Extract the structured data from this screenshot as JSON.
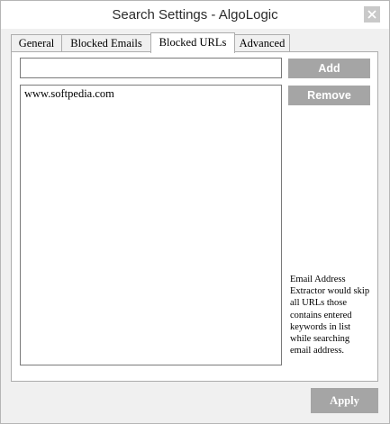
{
  "window": {
    "title": "Search Settings - AlgoLogic"
  },
  "tabs": [
    {
      "label": "General",
      "active": false
    },
    {
      "label": "Blocked Emails",
      "active": false
    },
    {
      "label": "Blocked URLs",
      "active": true
    },
    {
      "label": "Advanced",
      "active": false
    }
  ],
  "blocked_urls": {
    "input_value": "",
    "add_label": "Add",
    "remove_label": "Remove",
    "items": [
      "www.softpedia.com"
    ],
    "info_text": "Email Address Extractor would skip all URLs those contains entered keywords in list while searching email address."
  },
  "footer": {
    "apply_label": "Apply"
  },
  "colors": {
    "button_bg": "#a5a5a5",
    "button_text": "#ffffff",
    "window_bg": "#f0f0f0"
  },
  "icons": {
    "close": "close-icon"
  }
}
